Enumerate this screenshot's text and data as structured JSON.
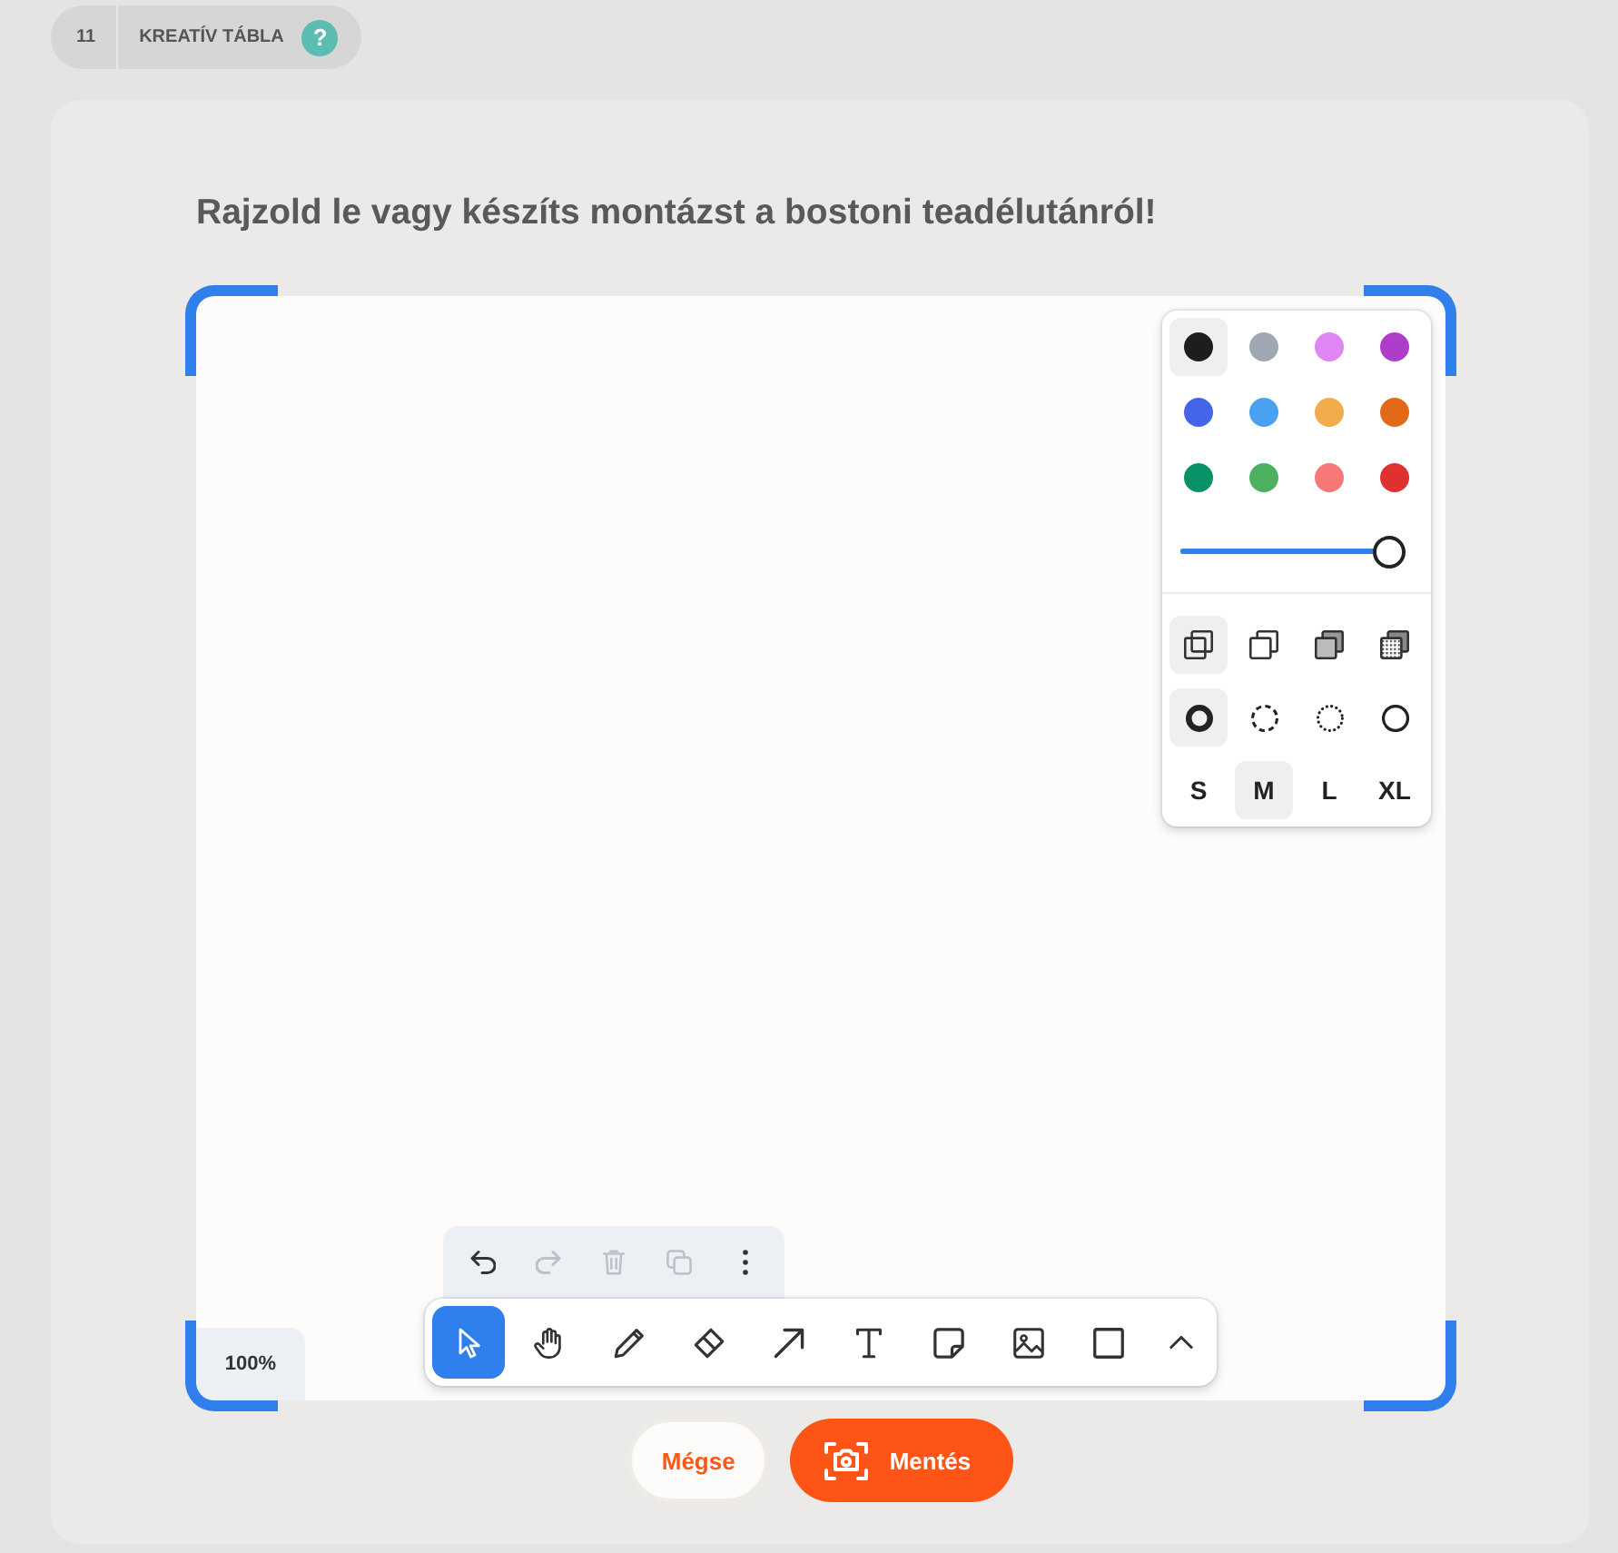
{
  "header": {
    "number": "11",
    "label": "KREATÍV TÁBLA",
    "help": "?"
  },
  "title": "Rajzold le vagy készíts montázst a bostoni teadélutánról!",
  "canvas": {
    "zoom": "100%"
  },
  "style_panel": {
    "colors": [
      {
        "color": "#1d1d1d",
        "selected": true
      },
      {
        "color": "#9fa8b2",
        "selected": false
      },
      {
        "color": "#e085f4",
        "selected": false
      },
      {
        "color": "#ae3ec9",
        "selected": false
      },
      {
        "color": "#4465e9",
        "selected": false
      },
      {
        "color": "#4ba1f1",
        "selected": false
      },
      {
        "color": "#f1ac4b",
        "selected": false
      },
      {
        "color": "#e16919",
        "selected": false
      },
      {
        "color": "#099268",
        "selected": false
      },
      {
        "color": "#4cb05e",
        "selected": false
      },
      {
        "color": "#f87777",
        "selected": false
      },
      {
        "color": "#e03131",
        "selected": false
      }
    ],
    "opacity": {
      "level": 1
    },
    "fills": [
      {
        "kind": "none",
        "selected": true
      },
      {
        "kind": "semi",
        "selected": false
      },
      {
        "kind": "solid",
        "selected": false
      },
      {
        "kind": "pattern",
        "selected": false
      }
    ],
    "dashes": [
      {
        "kind": "draw",
        "selected": true
      },
      {
        "kind": "dashed",
        "selected": false
      },
      {
        "kind": "dotted",
        "selected": false
      },
      {
        "kind": "solid",
        "selected": false
      }
    ],
    "sizes": [
      {
        "label": "S",
        "selected": false
      },
      {
        "label": "M",
        "selected": true
      },
      {
        "label": "L",
        "selected": false
      },
      {
        "label": "XL",
        "selected": false
      }
    ]
  },
  "actions": [
    {
      "kind": "undo",
      "disabled": false
    },
    {
      "kind": "redo",
      "disabled": true
    },
    {
      "kind": "delete",
      "disabled": true
    },
    {
      "kind": "duplicate",
      "disabled": true
    },
    {
      "kind": "more",
      "disabled": false
    }
  ],
  "tools": [
    {
      "kind": "select",
      "selected": true
    },
    {
      "kind": "hand",
      "selected": false
    },
    {
      "kind": "draw",
      "selected": false
    },
    {
      "kind": "eraser",
      "selected": false
    },
    {
      "kind": "arrow",
      "selected": false
    },
    {
      "kind": "text",
      "selected": false
    },
    {
      "kind": "note",
      "selected": false
    },
    {
      "kind": "media",
      "selected": false
    },
    {
      "kind": "rectangle",
      "selected": false
    },
    {
      "kind": "more",
      "selected": false
    }
  ],
  "buttons": [
    {
      "kind": "cancel",
      "label": "Mégse"
    },
    {
      "kind": "save",
      "label": "Mentés"
    }
  ]
}
